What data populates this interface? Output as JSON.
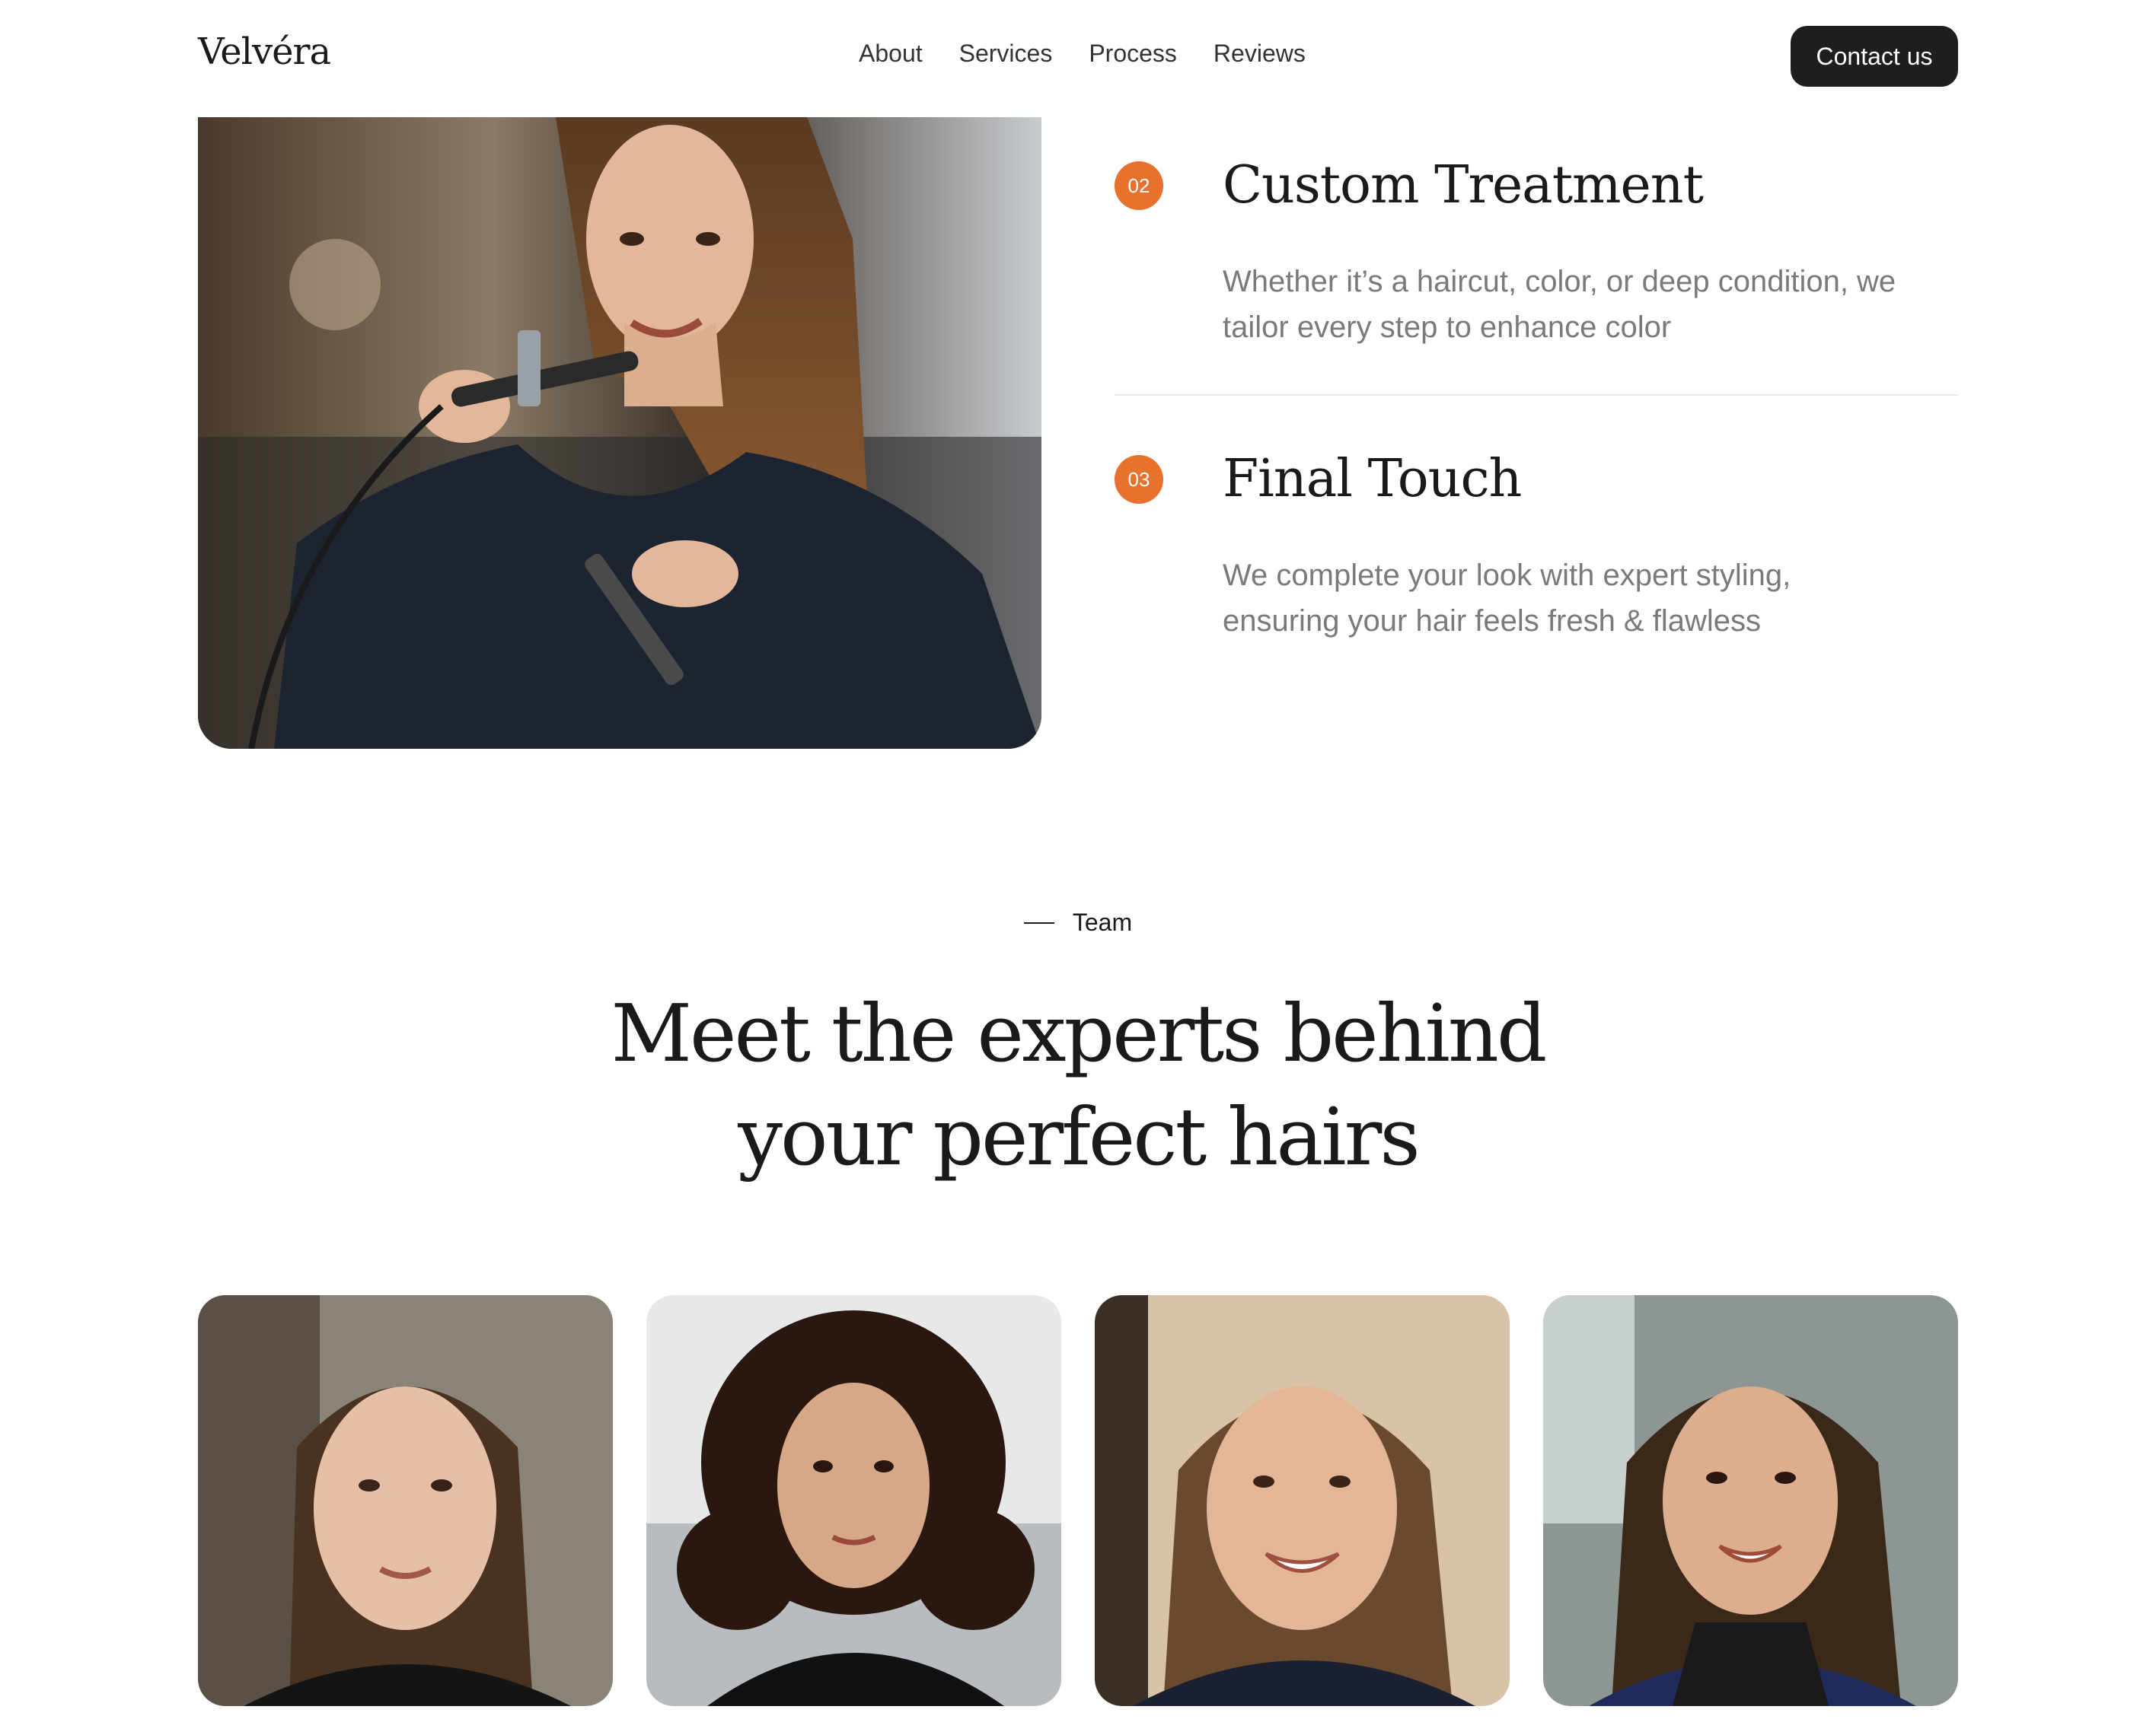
{
  "header": {
    "logo": "Velvéra",
    "nav": [
      "About",
      "Services",
      "Process",
      "Reviews"
    ],
    "cta": "Contact us"
  },
  "process": {
    "steps": [
      {
        "number": "02",
        "title": "Custom Treatment",
        "description": "Whether it’s a haircut, color, or deep condition, we tailor every step to enhance color"
      },
      {
        "number": "03",
        "title": "Final Touch",
        "description": "We complete your look with expert styling, ensuring your hair feels fresh & flawless"
      }
    ]
  },
  "team": {
    "eyebrow": "Team",
    "heading_line1": "Meet the experts behind",
    "heading_line2": "your perfect hairs"
  },
  "colors": {
    "accent": "#e8712d",
    "cta_bg": "#1e1e1e",
    "muted_text": "#7a7a7a"
  }
}
